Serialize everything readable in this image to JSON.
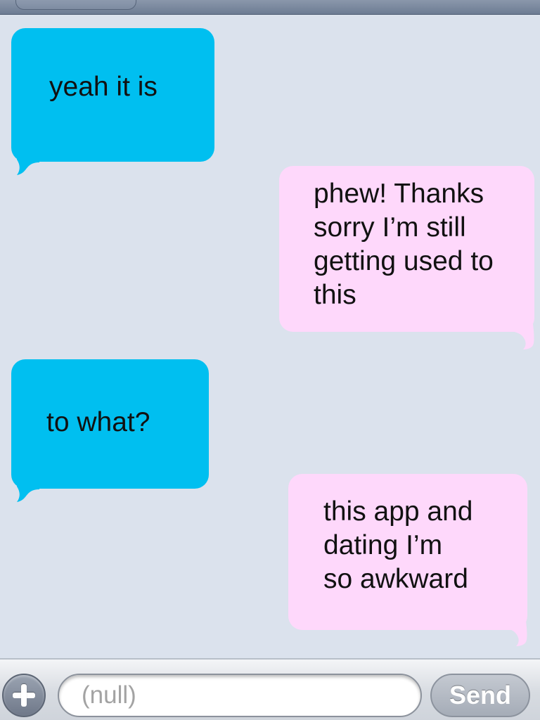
{
  "theme": {
    "background": "#dbe2ed",
    "incoming_bubble": "#00bff0",
    "outgoing_bubble": "#fed8fb"
  },
  "messages": [
    {
      "direction": "incoming",
      "text": "yeah it is"
    },
    {
      "direction": "outgoing",
      "text": "phew! Thanks\nsorry I’m still\ngetting used to\nthis"
    },
    {
      "direction": "incoming",
      "text": "to what?"
    },
    {
      "direction": "outgoing",
      "text": "this app and\ndating I’m\nso awkward"
    }
  ],
  "composer": {
    "placeholder": "(null)",
    "send_label": "Send",
    "add_icon": "plus-icon"
  }
}
